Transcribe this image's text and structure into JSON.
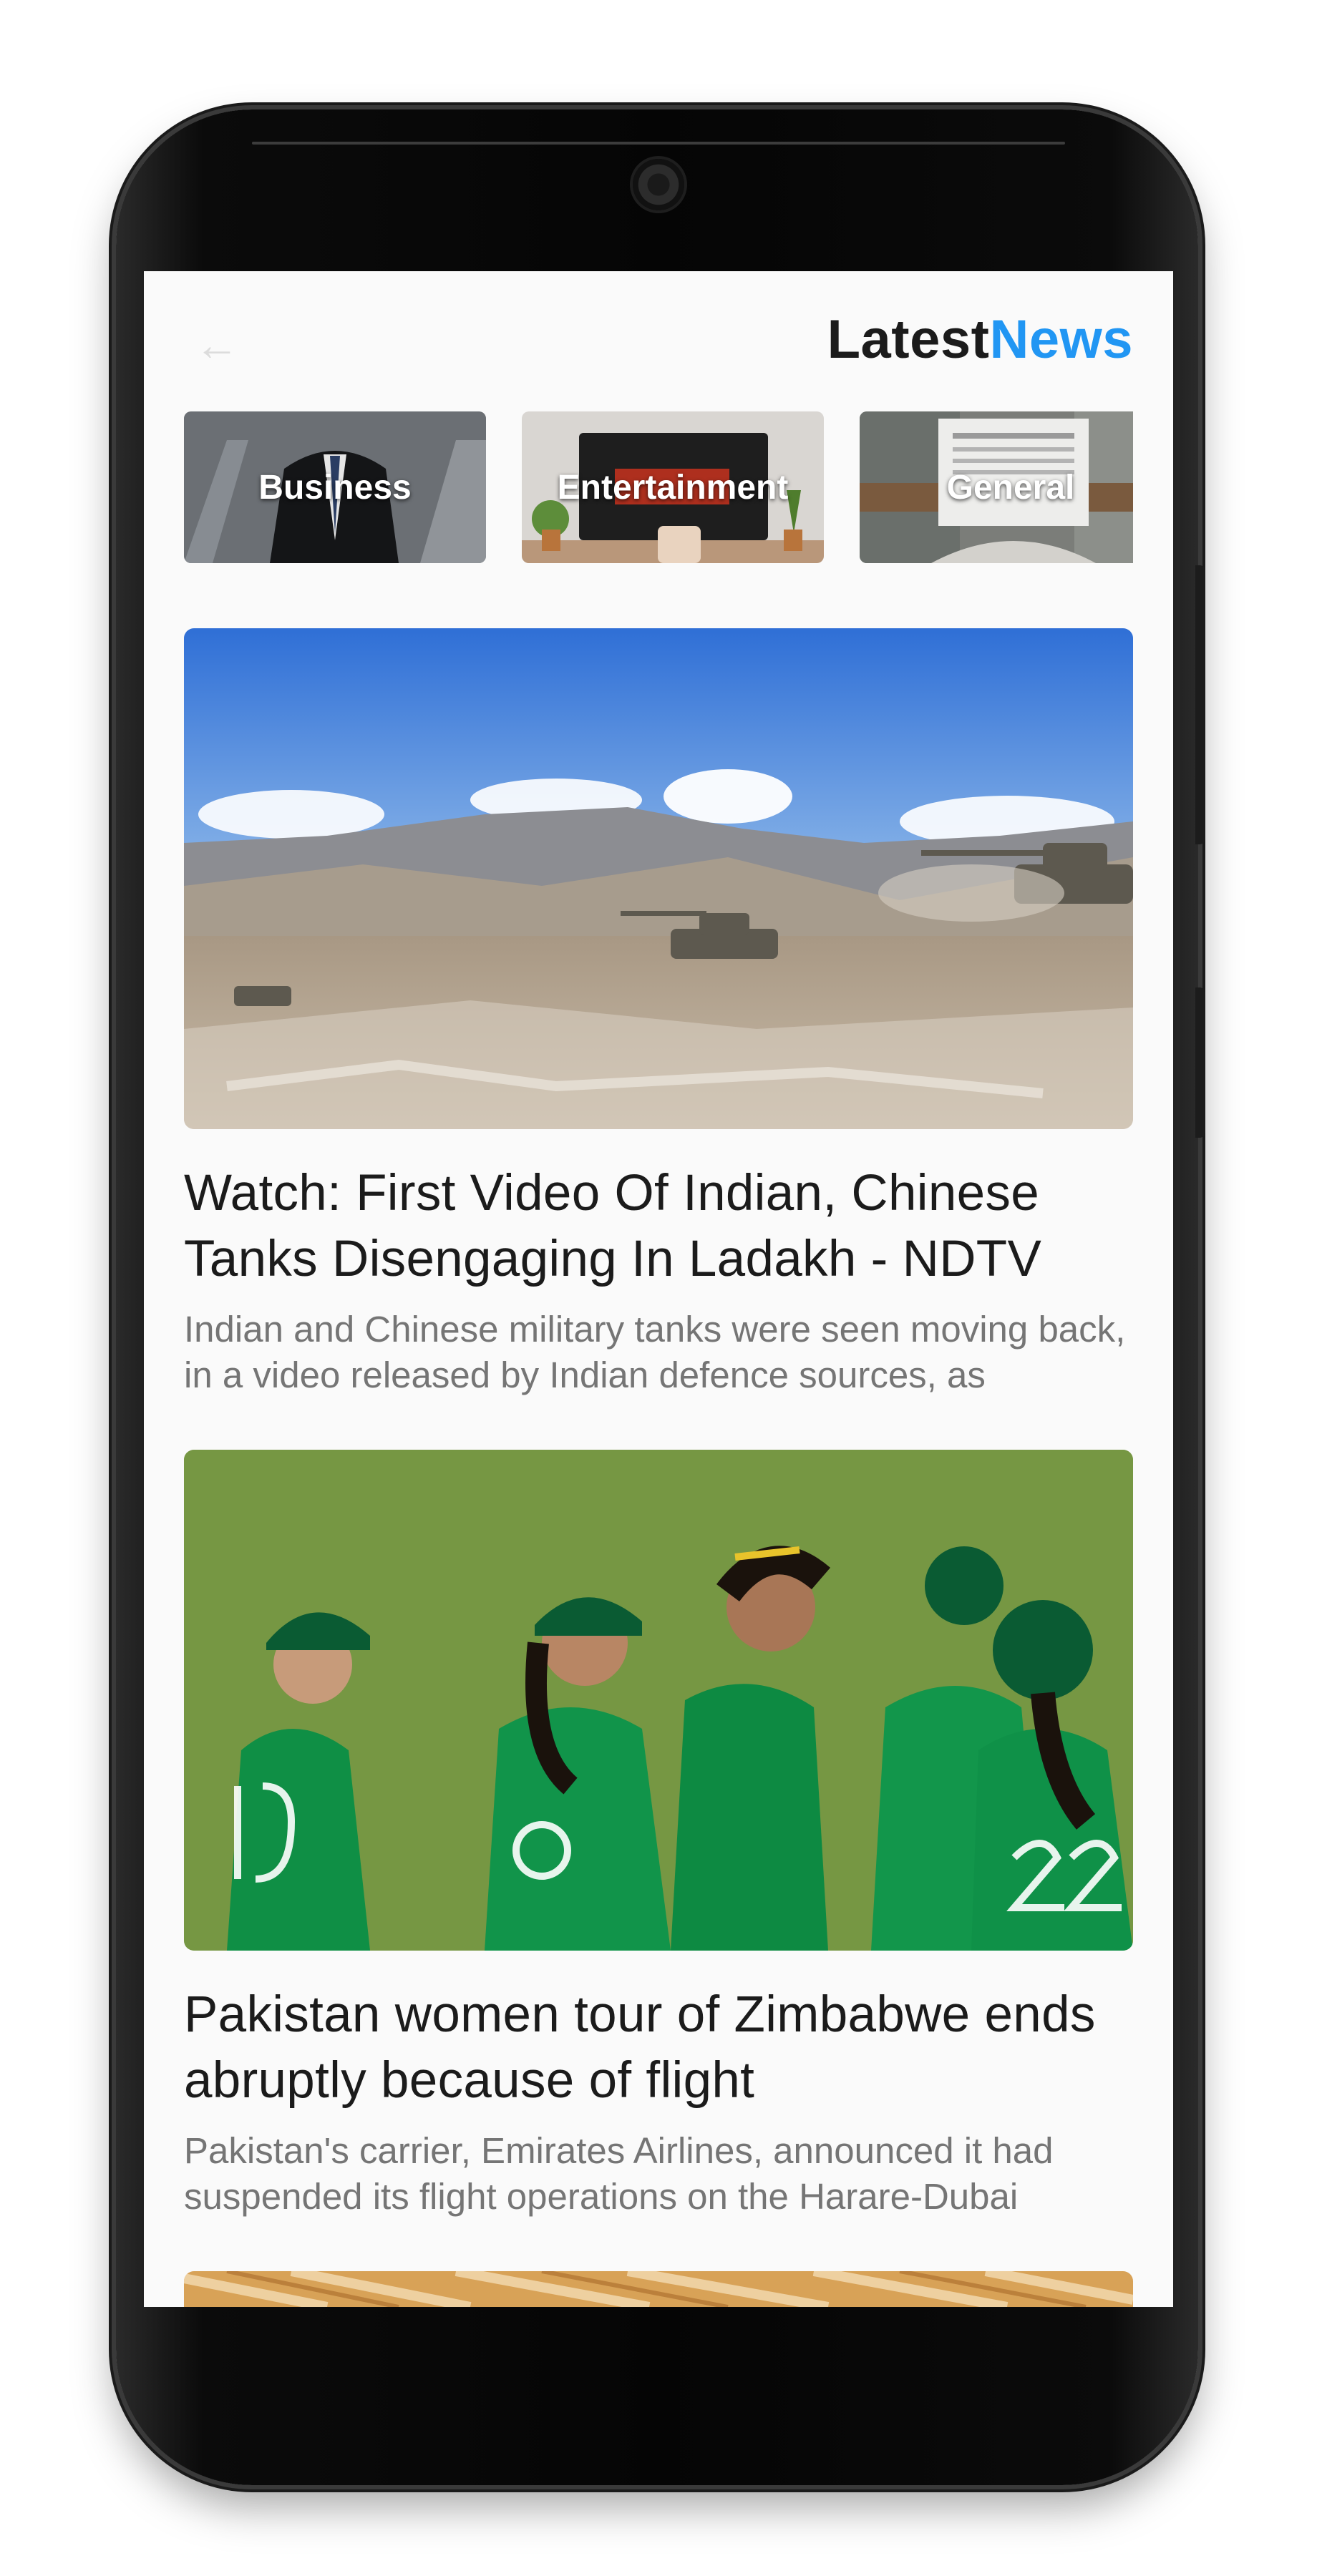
{
  "app": {
    "title_part1": "Latest",
    "title_part2": "News",
    "accent_color": "#2196f3",
    "back_icon": "arrow-back-icon"
  },
  "categories": [
    {
      "label": "Business"
    },
    {
      "label": "Entertainment"
    },
    {
      "label": "General"
    }
  ],
  "articles": [
    {
      "title": "Watch: First Video Of Indian, Chinese Tanks Disengaging In Ladakh - NDTV",
      "description": "Indian and Chinese military tanks were seen moving back, in a video released by Indian defence sources, as"
    },
    {
      "title": "Pakistan women tour of Zimbabwe ends abruptly because of flight",
      "description": "Pakistan's carrier, Emirates Airlines, announced it had suspended its flight operations on the Harare-Dubai"
    }
  ]
}
